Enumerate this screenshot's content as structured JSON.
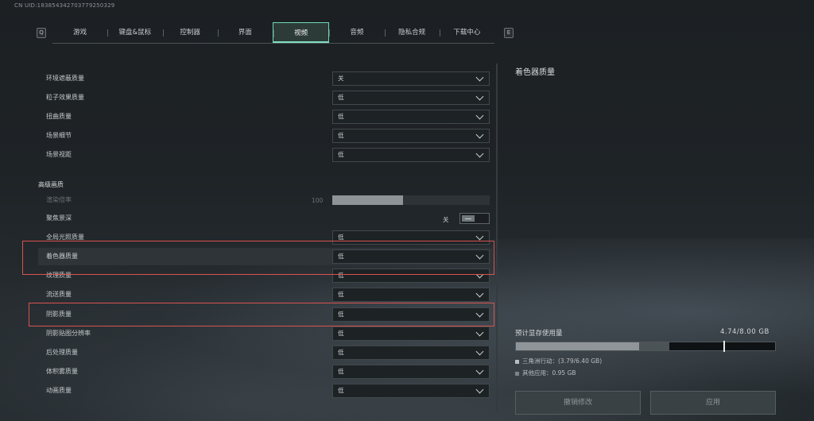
{
  "uid_text": "CN UID:183854342703779250329",
  "nav": {
    "left_key": "Q",
    "right_key": "E",
    "tabs": [
      "游戏",
      "键盘&鼠标",
      "控制器",
      "界面",
      "视频",
      "音频",
      "隐私合规",
      "下载中心"
    ],
    "active_tab": "视频"
  },
  "settings": [
    {
      "label": "环境遮蔽质量",
      "value": "关"
    },
    {
      "label": "粒子效果质量",
      "value": "低"
    },
    {
      "label": "扭曲质量",
      "value": "低"
    },
    {
      "label": "场景细节",
      "value": "低"
    },
    {
      "label": "场景视距",
      "value": "低"
    }
  ],
  "advanced": {
    "title": "高级画质",
    "render_scale": {
      "label": "渲染倍率",
      "value": "100",
      "fill_percent": 45
    },
    "dof": {
      "label": "聚焦景深",
      "value": "关"
    },
    "items": [
      {
        "label": "全局光照质量",
        "value": "低"
      },
      {
        "label": "着色器质量",
        "value": "低"
      },
      {
        "label": "纹理质量",
        "value": "低"
      },
      {
        "label": "流送质量",
        "value": "低"
      },
      {
        "label": "阴影质量",
        "value": "低"
      },
      {
        "label": "阴影贴图分辨率",
        "value": "低"
      },
      {
        "label": "后处理质量",
        "value": "低"
      },
      {
        "label": "体积雾质量",
        "value": "低"
      },
      {
        "label": "动画质量",
        "value": "低"
      }
    ]
  },
  "detail": {
    "title": "着色器质量"
  },
  "vram": {
    "label": "预计显存使用量",
    "value": "4.74/8.00 GB",
    "game_fraction": 0.474,
    "other_fraction": 0.119,
    "marker_fraction": 0.8,
    "legend_game": "三角洲行动：(3.79/6.40 GB)",
    "legend_other": "其他应用：0.95 GB",
    "game_color": "#8f9598",
    "other_color": "#4c5357"
  },
  "buttons": {
    "revert": "撤销修改",
    "apply": "应用"
  },
  "colors": {
    "accent": "#6fd7b5",
    "highlight_box": "#d9534f"
  }
}
